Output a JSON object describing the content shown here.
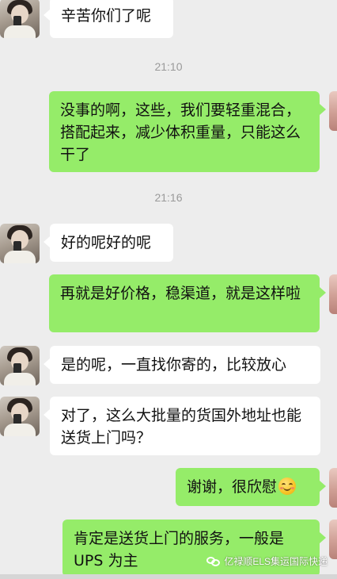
{
  "messages": [
    {
      "side": "left",
      "text": "辛苦你们了呢"
    },
    {
      "side": "time",
      "text": "21:10"
    },
    {
      "side": "right",
      "text": "没事的啊，这些，我们要轻重混合，搭配起来，减少体积重量，只能这么干了"
    },
    {
      "side": "time",
      "text": "21:16"
    },
    {
      "side": "left",
      "text": "好的呢好的呢"
    },
    {
      "side": "right",
      "text": "再就是好价格，稳渠道，就是这样啦"
    },
    {
      "side": "left",
      "text": "是的呢，一直找你寄的，比较放心"
    },
    {
      "side": "left",
      "text": "对了，这么大批量的货国外地址也能送货上门吗？"
    },
    {
      "side": "right",
      "text": "谢谢，很欣慰",
      "emoji": "smiling-blush-emoji"
    },
    {
      "side": "right",
      "text": "肯定是送货上门的服务，一般是UPS 为主"
    }
  ],
  "watermark": {
    "text": "亿禄顺ELS集运国际快递",
    "icon": "wechat-official-account-icon"
  },
  "colors": {
    "background": "#ededed",
    "outgoing_bubble": "#95ec69",
    "incoming_bubble": "#ffffff",
    "timestamp": "#9a9a9a"
  }
}
